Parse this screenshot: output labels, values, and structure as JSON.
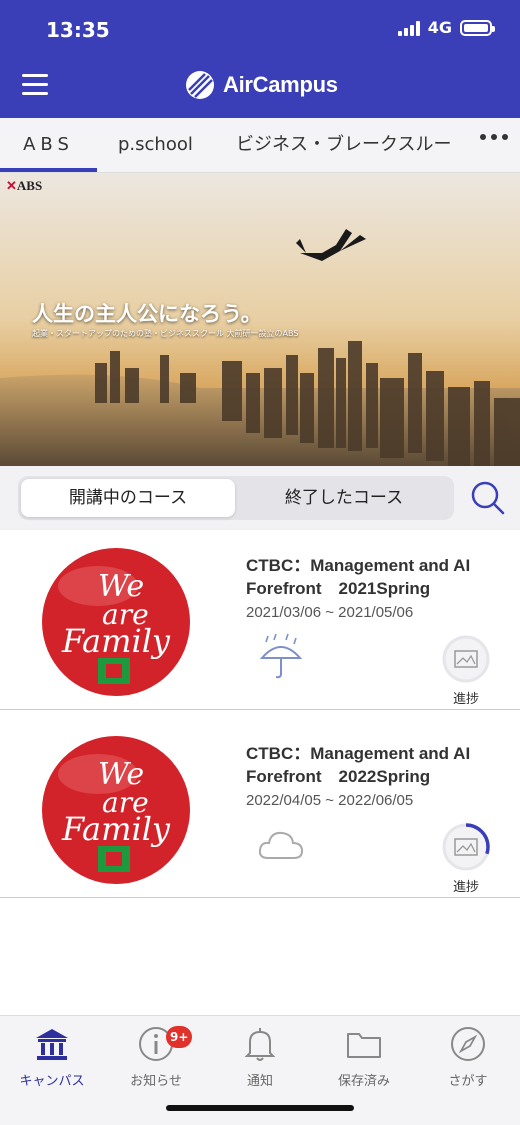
{
  "status_bar": {
    "time": "13:35",
    "network": "4G"
  },
  "header": {
    "app_name": "AirCampus"
  },
  "tabs": [
    {
      "label": "ABS",
      "active": true
    },
    {
      "label": "p.school",
      "active": false
    },
    {
      "label": "ビジネス・ブレークスルー",
      "active": false
    }
  ],
  "banner": {
    "brand": "ABS",
    "headline": "人生の主人公になろう。",
    "subline": "起業・スタートアップのための塾・ビジネススクール 大前研一設立のABS"
  },
  "segmented": {
    "active_label": "開講中のコース",
    "inactive_label": "終了したコース"
  },
  "courses": [
    {
      "title": "CTBC：Management and AI\nForefront　2021Spring",
      "dates": "2021/03/06 ~ 2021/05/06",
      "weather_icon": "umbrella-rain-icon",
      "progress_label": "進捗",
      "progress": 0
    },
    {
      "title": "CTBC：Management and AI\nForefront　2022Spring",
      "dates": "2022/04/05 ~ 2022/06/05",
      "weather_icon": "cloud-icon",
      "progress_label": "進捗",
      "progress": 0.3
    }
  ],
  "bottom_nav": [
    {
      "label": "キャンパス",
      "icon": "campus-building-icon",
      "active": true
    },
    {
      "label": "お知らせ",
      "icon": "info-icon",
      "badge": "9+"
    },
    {
      "label": "通知",
      "icon": "bell-icon"
    },
    {
      "label": "保存済み",
      "icon": "folder-icon"
    },
    {
      "label": "さがす",
      "icon": "compass-icon"
    }
  ],
  "colors": {
    "primary": "#3a3fb8",
    "badge": "#e0322b",
    "logo_red": "#d2232a"
  }
}
